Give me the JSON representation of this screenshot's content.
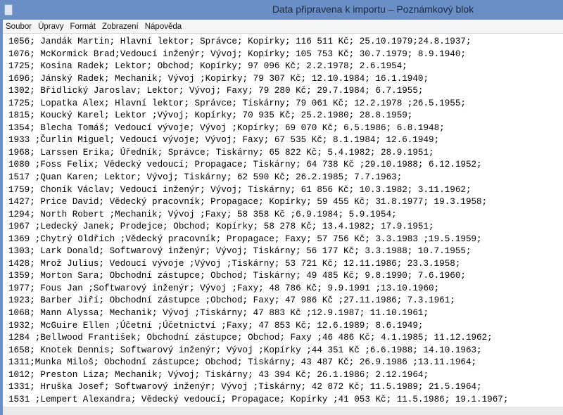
{
  "window": {
    "title": "Data připravena k importu – Poznámkový blok",
    "icon": "notepad-icon"
  },
  "menu": [
    "Soubor",
    "Úpravy",
    "Formát",
    "Zobrazení",
    "Nápověda"
  ],
  "lines": [
    "1056; Jandák Martin; Hlavní lektor; Správce; Kopírky; 116 511 Kč; 25.10.1979;24.8.1937;",
    "1076; McKormick Brad;Vedoucí inženýr; Vývoj; Kopírky; 105 753 Kč; 30.7.1979; 8.9.1940;",
    "1725; Kosina Radek; Lektor; Obchod; Kopírky; 97 096 Kč; 2.2.1978; 2.6.1954;",
    "1696; Jánský Radek; Mechanik; Vývoj ;Kopírky; 79 307 Kč; 12.10.1984; 16.1.1940;",
    "1302; Břidlický Jaroslav; Lektor; Vývoj; Faxy; 79 280 Kč; 29.7.1984; 6.7.1955;",
    "1725; Lopatka Alex; Hlavní lektor; Správce; Tiskárny; 79 061 Kč; 12.2.1978 ;26.5.1955;",
    "1815; Koucký Karel; Lektor ;Vývoj; Kopírky; 70 935 Kč; 25.2.1980; 28.8.1959;",
    "1354; Blecha Tomáš; Vedoucí vývoje; Vývoj ;Kopírky; 69 070 Kč; 6.5.1986; 6.8.1948;",
    "1933 ;Čurlin Miguel; Vedoucí vývoje; Vývoj; Faxy; 67 535 Kč; 8.1.1984; 12.6.1949;",
    "1968; Larssen Erika; Úředník; Správce; Tiskárny; 65 822 Kč; 5.4.1982; 28.9.1951;",
    "1080 ;Foss Felix; Vědecký vedoucí; Propagace; Tiskárny; 64 738 Kč ;29.10.1988; 6.12.1952;",
    "1517 ;Quan Karen; Lektor; Vývoj; Tiskárny; 62 590 Kč; 26.2.1985; 7.7.1963;",
    "1759; Choník Václav; Vedoucí inženýr; Vývoj; Tiskárny; 61 856 Kč; 10.3.1982; 3.11.1962;",
    "1427; Price David; Vědecký pracovník; Propagace; Kopírky; 59 455 Kč; 31.8.1977; 19.3.1958;",
    "1294; North Robert ;Mechanik; Vývoj ;Faxy; 58 358 Kč ;6.9.1984; 5.9.1954;",
    "1967 ;Ledecký Janek; Prodejce; Obchod; Kopírky; 58 278 Kč; 13.4.1982; 17.9.1951;",
    "1369 ;Chytrý Oldřich ;Vědecký pracovník; Propagace; Faxy; 57 756 Kč; 3.3.1983 ;19.5.1959;",
    "1303; Lark Donald; Softwarový inženýr; Vývoj; Tiskárny; 56 177 Kč; 3.3.1988; 10.7.1955;",
    "1428; Mrož Julius; Vedoucí vývoje ;Vývoj ;Tiskárny; 53 721 Kč; 12.11.1986; 23.3.1958;",
    "1359; Morton Sara; Obchodní zástupce; Obchod; Tiskárny; 49 485 Kč; 9.8.1990; 7.6.1960;",
    "1977; Fous Jan ;Softwarový inženýr; Vývoj ;Faxy; 48 786 Kč; 9.9.1991 ;13.10.1960;",
    "1923; Barber Jiří; Obchodní zástupce ;Obchod; Faxy; 47 986 Kč ;27.11.1986; 7.3.1961;",
    "1068; Mann Alyssa; Mechanik; Vývoj ;Tiskárny; 47 883 Kč ;12.9.1987; 11.10.1961;",
    "1932; McGuire Ellen ;Účetní ;Účetnictví ;Faxy; 47 853 Kč; 12.6.1989; 8.6.1949;",
    "1284 ;Bellwood František; Obchodní zástupce; Obchod; Faxy ;46 486 Kč; 4.1.1985; 11.12.1962;",
    "1658; Knotek Dennis; Softwarový inženýr; Vývoj ;Kopírky ;44 351 Kč ;6.6.1988; 14.10.1963;",
    "1311;Munka Miloš; Obchodní zástupce; Obchod; Tiskárny; 43 487 Kč; 26.9.1986 ;13.11.1964;",
    "1012; Preston Liza; Mechanik; Vývoj; Tiskárny; 43 394 Kč; 26.1.1986; 2.12.1964;",
    "1331; Hruška Josef; Softwarový inženýr; Vývoj ;Tiskárny; 42 872 Kč; 11.5.1989; 21.5.1964;",
    "1531 ;Lempert Alexandra; Vědecký vedoucí; Propagace; Kopírky ;41 053 Kč; 11.5.1986; 19.1.1967;"
  ]
}
